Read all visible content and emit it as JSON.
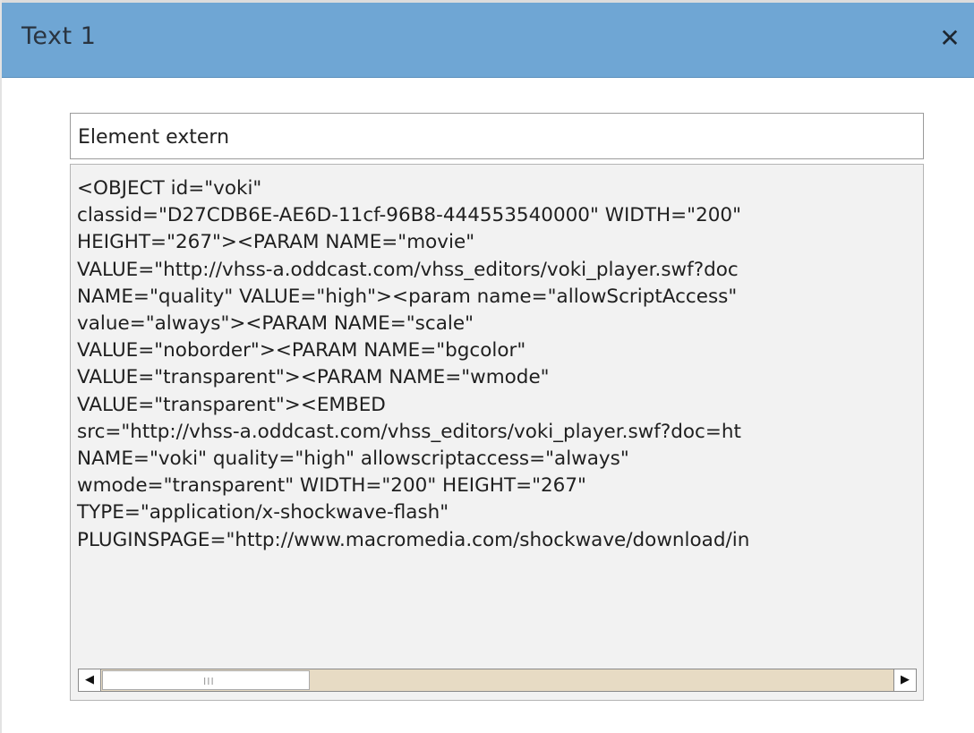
{
  "dialog": {
    "title": "Text 1",
    "close_symbol": "✕",
    "close_icon": "close-icon"
  },
  "name_field": {
    "value": "Element extern"
  },
  "code_editor": {
    "lines": [
      "<OBJECT id=\"voki\"",
      "classid=\"D27CDB6E-AE6D-11cf-96B8-444553540000\" WIDTH=\"200\"",
      "HEIGHT=\"267\"><PARAM NAME=\"movie\"",
      "VALUE=\"http://vhss-a.oddcast.com/vhss_editors/voki_player.swf?doc",
      "NAME=\"quality\" VALUE=\"high\"><param name=\"allowScriptAccess\"",
      "value=\"always\"><PARAM NAME=\"scale\"",
      "VALUE=\"noborder\"><PARAM NAME=\"bgcolor\"",
      "VALUE=\"transparent\"><PARAM NAME=\"wmode\"",
      "VALUE=\"transparent\"><EMBED",
      "src=\"http://vhss-a.oddcast.com/vhss_editors/voki_player.swf?doc=ht",
      "NAME=\"voki\" quality=\"high\" allowscriptaccess=\"always\"",
      "wmode=\"transparent\" WIDTH=\"200\" HEIGHT=\"267\"",
      "TYPE=\"application/x-shockwave-flash\"",
      "PLUGINSPAGE=\"http://www.macromedia.com/shockwave/download/in"
    ]
  },
  "scrollbar": {
    "left_arrow": "◀",
    "right_arrow": "▶",
    "grip": "III",
    "left_arrow_icon": "arrow-left-icon",
    "right_arrow_icon": "arrow-right-icon"
  },
  "colors": {
    "titlebar": "#6fa6d4",
    "editor_bg": "#f2f2f2",
    "scroll_track": "#e7dbc4"
  }
}
